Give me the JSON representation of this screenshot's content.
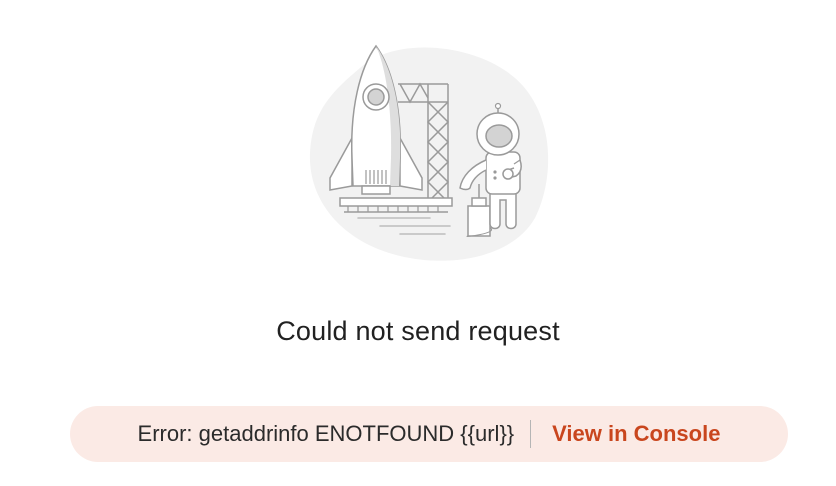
{
  "message": {
    "title": "Could not send request"
  },
  "error": {
    "text": "Error: getaddrinfo ENOTFOUND {{url}}",
    "link_label": "View in Console"
  },
  "illustration": {
    "icon": "rocket-astronaut-illustration"
  },
  "colors": {
    "error_background": "#fbeae5",
    "link": "#c9461e",
    "title": "#212121"
  }
}
